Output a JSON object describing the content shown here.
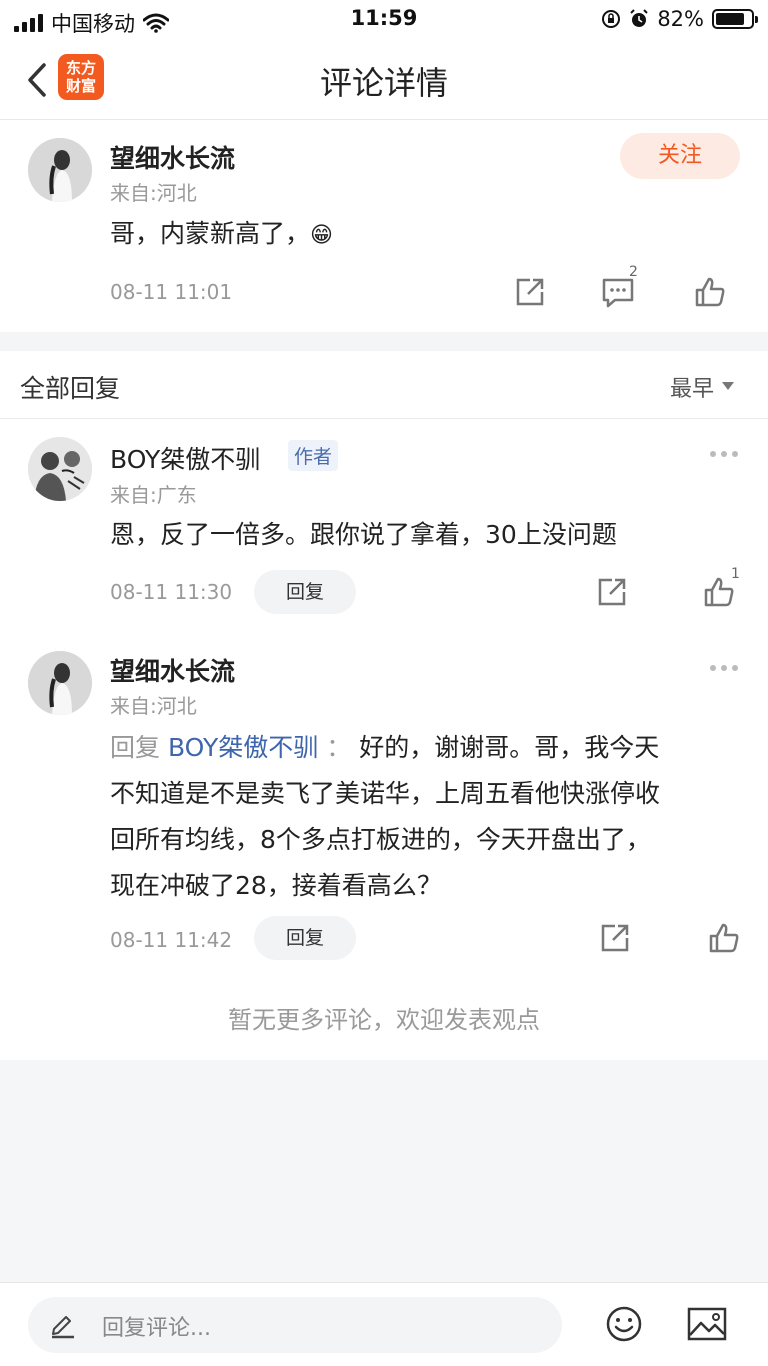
{
  "status_bar": {
    "carrier": "中国移动",
    "time": "11:59",
    "battery": "82%",
    "battery_level": 0.82
  },
  "nav": {
    "title": "评论详情",
    "logo_line1": "东方",
    "logo_line2": "财富"
  },
  "main_comment": {
    "username": "望细水长流",
    "from": "来自:河北",
    "text": "哥，内蒙新高了，",
    "emoji": "😁",
    "time": "08-11 11:01",
    "follow_label": "关注",
    "comment_count": "2"
  },
  "replies_header": {
    "label": "全部回复",
    "sort": "最早"
  },
  "replies": [
    {
      "username": "BOY桀傲不驯",
      "tag": "作者",
      "from": "来自:广东",
      "text": "恩，反了一倍多。跟你说了拿着，30上没问题",
      "time": "08-11 11:30",
      "reply_label": "回复",
      "like_count": "1"
    },
    {
      "username": "望细水长流",
      "from": "来自:河北",
      "reply_prefix": "回复",
      "reply_to": "BOY桀傲不驯",
      "colon": "：",
      "line1": "好的，谢谢哥。哥，我今天",
      "line2": "不知道是不是卖飞了美诺华，上周五看他快涨停收",
      "line3": "回所有均线，8个多点打板进的，今天开盘出了，",
      "line4": "现在冲破了28，接着看高么？",
      "time": "08-11 11:42",
      "reply_label": "回复"
    }
  ],
  "no_more": "暂无更多评论，欢迎发表观点",
  "bottom_bar": {
    "placeholder": "回复评论..."
  }
}
